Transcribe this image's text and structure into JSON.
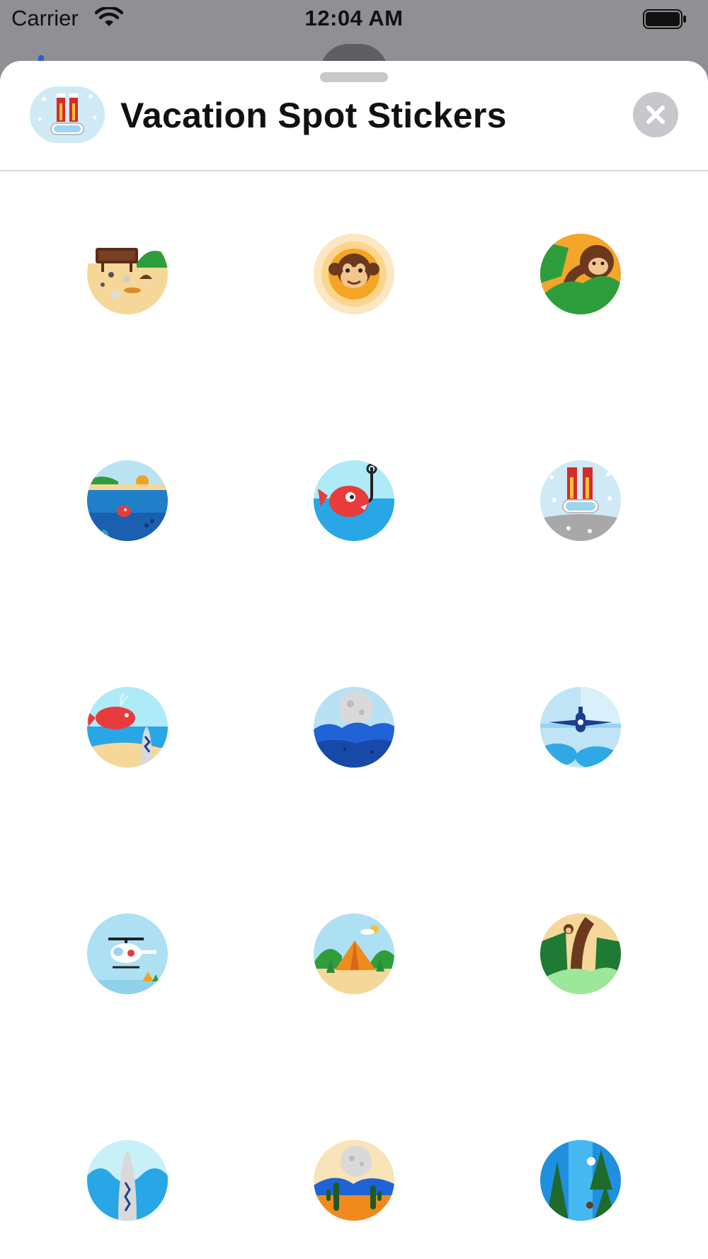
{
  "status_bar": {
    "carrier": "Carrier",
    "time": "12:04 AM",
    "icons": [
      "wifi-icon",
      "battery-icon"
    ]
  },
  "header": {
    "title": "Vacation Spot Stickers",
    "app_icon": "ski-goggles-icon",
    "close_icon": "close-icon"
  },
  "colors": {
    "sheet": "#ffffff",
    "dimmed_background": "#8f8f94",
    "close_button": "#c7c7cc",
    "divider": "#dcdcdf"
  },
  "stickers": [
    {
      "name": "forbidden-area-sign-sticker"
    },
    {
      "name": "monkey-face-sticker"
    },
    {
      "name": "monkey-in-jungle-sticker"
    },
    {
      "name": "underwater-fish-sticker"
    },
    {
      "name": "fish-on-hook-sticker"
    },
    {
      "name": "ski-goggles-sticker"
    },
    {
      "name": "whale-and-surfboard-sticker"
    },
    {
      "name": "moon-over-waves-sticker"
    },
    {
      "name": "airplane-in-clouds-sticker"
    },
    {
      "name": "helicopter-sticker"
    },
    {
      "name": "camping-tent-sticker"
    },
    {
      "name": "jungle-tree-monkey-sticker"
    },
    {
      "name": "surfboard-wave-sticker"
    },
    {
      "name": "desert-cactus-moon-sticker"
    },
    {
      "name": "forest-waterfall-sticker"
    }
  ]
}
